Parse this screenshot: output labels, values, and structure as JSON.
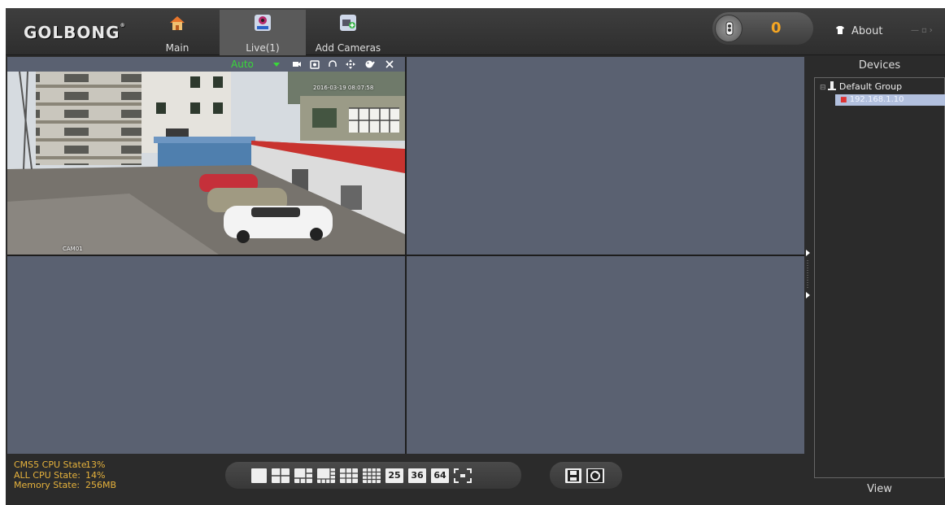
{
  "app": {
    "logo": "GOLBONG",
    "logo_mark": "®"
  },
  "nav": {
    "main_label": "Main",
    "live_label": "Live(1)",
    "add_label": "Add Cameras"
  },
  "alarm": {
    "count": "0"
  },
  "about_label": "About",
  "camera": {
    "stream_mode": "Auto",
    "osd_name": "CAM01",
    "osd_time": "2016-03-19 08:07:58"
  },
  "devices": {
    "title": "Devices",
    "group": "Default Group",
    "device_ip": "192.168.1.10",
    "view_label": "View"
  },
  "status": {
    "cms_label": "CMS5 CPU State:",
    "cms_value": "13%",
    "all_label": "ALL CPU State:",
    "all_value": "14%",
    "mem_label": "Memory State:",
    "mem_value": "256MB"
  },
  "layouts": {
    "l25": "25",
    "l36": "36",
    "l64": "64"
  },
  "colors": {
    "accent_green": "#39d839",
    "status_amber": "#e6b23c",
    "alarm_orange": "#f5a623",
    "cell_bg": "#5a6171"
  }
}
